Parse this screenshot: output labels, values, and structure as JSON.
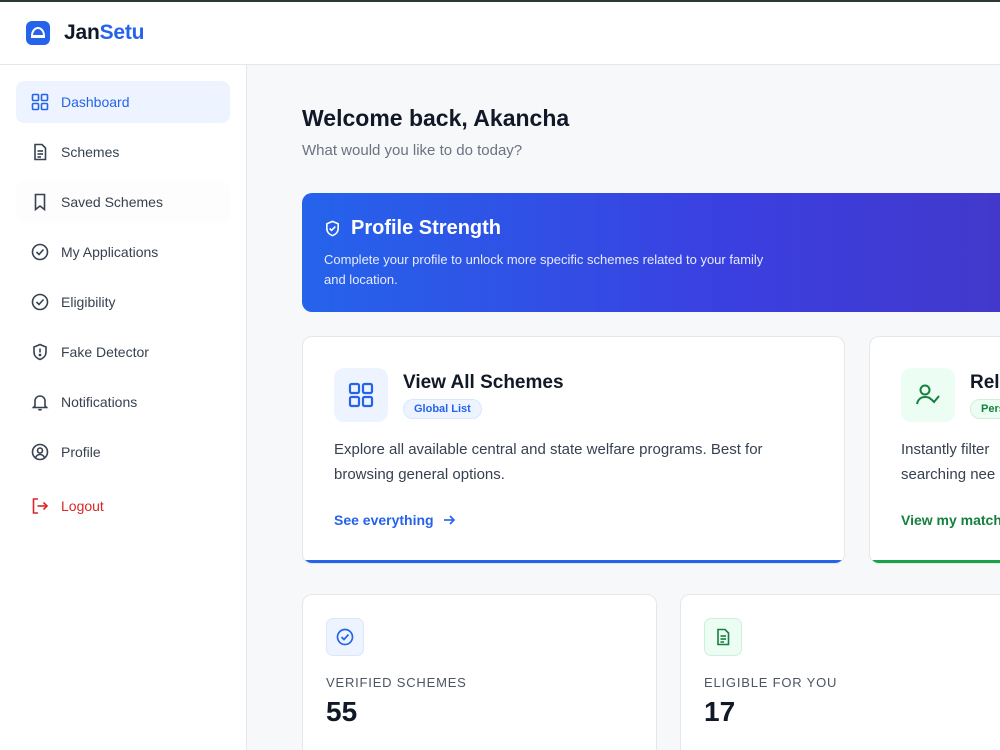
{
  "app": {
    "brand_part1": "Jan",
    "brand_part2": "Setu",
    "logo_icon": "app-logo-icon",
    "accent_color": "#2563eb"
  },
  "sidebar": {
    "items": [
      {
        "label": "Dashboard",
        "icon": "grid-icon",
        "active": true
      },
      {
        "label": "Schemes",
        "icon": "document-icon"
      },
      {
        "label": "Saved Schemes",
        "icon": "bookmark-icon"
      },
      {
        "label": "My Applications",
        "icon": "check-circle-icon"
      },
      {
        "label": "Eligibility",
        "icon": "check-circle-icon"
      },
      {
        "label": "Fake Detector",
        "icon": "shield-alert-icon"
      },
      {
        "label": "Notifications",
        "icon": "bell-icon"
      },
      {
        "label": "Profile",
        "icon": "user-circle-icon"
      }
    ],
    "logout": {
      "label": "Logout",
      "icon": "logout-icon",
      "color": "#dc2626"
    }
  },
  "main": {
    "greeting": "Welcome back, Akancha",
    "subtitle": "What would you like to do today?",
    "profile_strength": {
      "title": "Profile Strength",
      "icon": "shield-check-icon",
      "description": "Complete your profile to unlock more specific schemes related to your family and location.",
      "colors": [
        "#2563eb",
        "#4338ca"
      ]
    },
    "cards": [
      {
        "title": "View All Schemes",
        "badge": "Global List",
        "icon": "grid-icon",
        "description": "Explore all available central and state welfare programs. Best for browsing general options.",
        "link": "See everything",
        "color": "#2563eb"
      },
      {
        "title": "Rele",
        "badge": "Pers",
        "icon": "user-check-icon",
        "description": "Instantly filter searching nee",
        "link": "View my match",
        "color": "#15803d"
      }
    ],
    "stats": [
      {
        "label": "VERIFIED SCHEMES",
        "value": "55",
        "icon": "check-circle-icon"
      },
      {
        "label": "ELIGIBLE FOR YOU",
        "value": "17",
        "icon": "document-icon"
      }
    ]
  }
}
